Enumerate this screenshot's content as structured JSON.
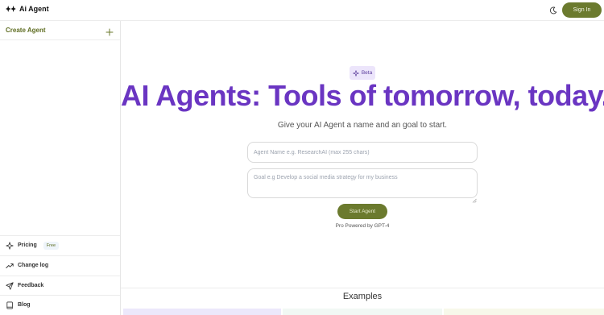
{
  "header": {
    "logo_icon": "sparkle-pair-icon",
    "brand": "Ai Agent",
    "theme_toggle_icon": "moon-icon",
    "signin_label": "Sign In"
  },
  "sidebar": {
    "create_label": "Create Agent",
    "create_icon": "plus-icon",
    "items": [
      {
        "label": "Pricing",
        "icon": "sparkle-icon",
        "badge": "Free"
      },
      {
        "label": "Change log",
        "icon": "trend-up-icon"
      },
      {
        "label": "Feedback",
        "icon": "send-icon"
      },
      {
        "label": "Blog",
        "icon": "book-icon"
      }
    ]
  },
  "hero": {
    "badge": "Beta",
    "badge_icon": "sparkle-icon",
    "title": "AI Agents: Tools of tomorrow, today.",
    "subtitle": "Give your AI Agent a name and an goal to start."
  },
  "form": {
    "name_placeholder": "Agent Name e.g. ResearchAI (max 255 chars)",
    "goal_placeholder": "Goal e.g Develop a social media strategy for my business",
    "start_label": "Start Agent",
    "powered_by": "Pro Powered by GPT-4"
  },
  "examples": {
    "title": "Examples"
  },
  "colors": {
    "accent_olive": "#6b7a2e",
    "title_purple": "#6a35c2",
    "badge_bg": "#ece5fb"
  }
}
